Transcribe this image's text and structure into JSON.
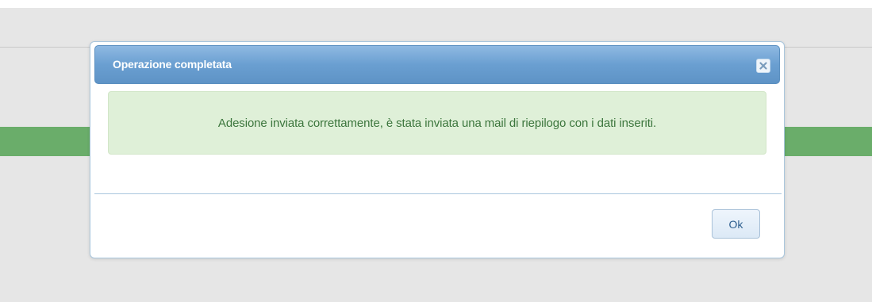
{
  "dialog": {
    "title": "Operazione completata",
    "close_icon": "close-icon",
    "message": "Adesione inviata correttamente, è stata inviata una mail di riepilogo con i dati inseriti.",
    "ok_label": "Ok"
  },
  "colors": {
    "title_bar": "#6a9fd1",
    "alert_background": "#dff0d8",
    "alert_text": "#3c763d",
    "page_band": "#6aad6a"
  }
}
